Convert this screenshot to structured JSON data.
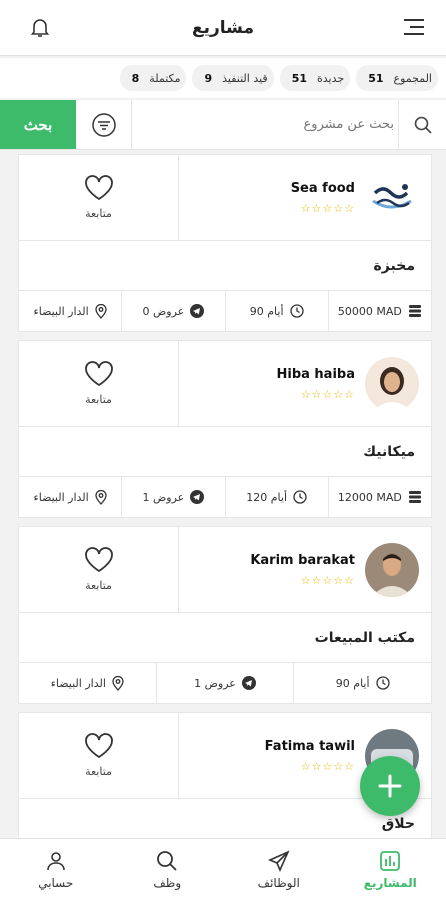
{
  "header": {
    "title": "مشاريع",
    "bell_icon": "bell-icon",
    "menu_icon": "menu-icon"
  },
  "stats": [
    {
      "label": "المجموع",
      "value": "51"
    },
    {
      "label": "جديدة",
      "value": "51"
    },
    {
      "label": "قيد التنفيذ",
      "value": "9"
    },
    {
      "label": "مكتملة",
      "value": "8"
    }
  ],
  "search": {
    "placeholder": "بحث عن مشروع",
    "button_label": "بحث"
  },
  "projects": [
    {
      "owner": "Sea food",
      "follow_label": "متابعة",
      "title": "مخبزة",
      "budget": "50000 MAD",
      "duration": "90 أيام",
      "offers": "0 عروض",
      "location": "الدار البيضاء",
      "rating_stars": "☆☆☆☆☆"
    },
    {
      "owner": "Hiba haiba",
      "follow_label": "متابعة",
      "title": "ميكانيك",
      "budget": "12000 MAD",
      "duration": "120 أيام",
      "offers": "1 عروض",
      "location": "الدار البيضاء",
      "rating_stars": "☆☆☆☆☆"
    },
    {
      "owner": "Karim barakat",
      "follow_label": "متابعة",
      "title": "مكتب المبيعات",
      "duration": "90 أيام",
      "offers": "1 عروض",
      "location": "الدار البيضاء",
      "rating_stars": "☆☆☆☆☆"
    },
    {
      "owner": "Fatima tawil",
      "follow_label": "متابعة",
      "title": "حلاق",
      "rating_stars": "☆☆☆☆☆"
    }
  ],
  "bottom_nav": [
    {
      "label": "المشاريع",
      "icon": "projects-icon",
      "active": true
    },
    {
      "label": "الوظائف",
      "icon": "send-icon"
    },
    {
      "label": "وظف",
      "icon": "search-icon"
    },
    {
      "label": "حسابي",
      "icon": "user-icon"
    }
  ],
  "colors": {
    "accent": "#3dbb6a",
    "star": "#e6b800"
  }
}
